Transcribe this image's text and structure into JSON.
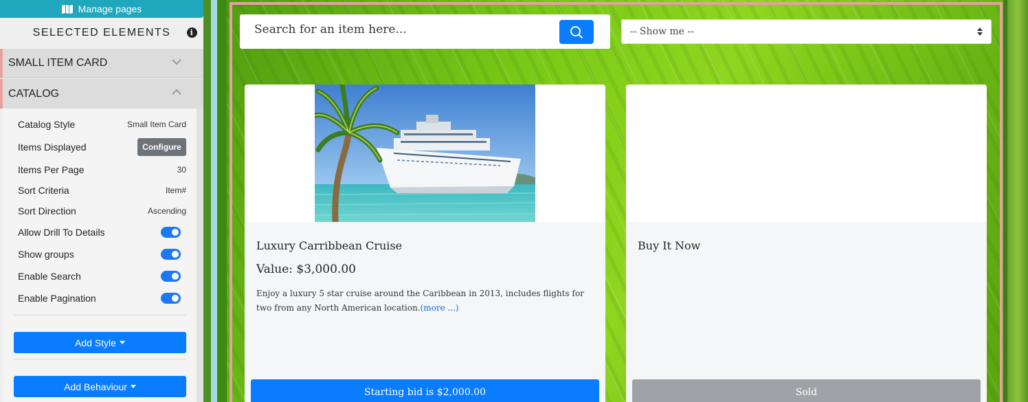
{
  "sidebar": {
    "manage_pages_label": "Manage pages",
    "selected_header": "SELECTED ELEMENTS",
    "info_glyph": "i",
    "accordions": [
      {
        "label": "SMALL ITEM CARD",
        "expanded": false
      },
      {
        "label": "CATALOG",
        "expanded": true
      }
    ],
    "catalog_props": {
      "catalog_style": {
        "label": "Catalog Style",
        "value": "Small Item Card"
      },
      "items_displayed": {
        "label": "Items Displayed",
        "button": "Configure"
      },
      "items_per_page": {
        "label": "Items Per Page",
        "value": "30"
      },
      "sort_criteria": {
        "label": "Sort Criteria",
        "value": "Item#"
      },
      "sort_direction": {
        "label": "Sort Direction",
        "value": "Ascending"
      },
      "allow_drill": {
        "label": "Allow Drill To Details",
        "on": true
      },
      "show_groups": {
        "label": "Show groups",
        "on": true
      },
      "enable_search": {
        "label": "Enable Search",
        "on": true
      },
      "enable_pagination": {
        "label": "Enable Pagination",
        "on": true
      }
    },
    "add_style_label": "Add Style",
    "add_behaviour_label": "Add Behaviour"
  },
  "main": {
    "search_placeholder": "Search for an item here...",
    "filter_select": {
      "selected": "-- Show me --"
    },
    "cards": [
      {
        "title": "Luxury Carribbean Cruise",
        "value": "Value: $3,000.00",
        "description": "Enjoy a luxury 5 star cruise around the Caribbean in 2013, includes flights for two from any North American location.",
        "more_link": "(more ...)",
        "button": "Starting bid is $2,000.00",
        "has_image": true
      },
      {
        "title": "Buy It Now",
        "button": "Sold",
        "has_image": false
      }
    ]
  },
  "colors": {
    "accent_blue": "#0a7cff",
    "teal": "#1ea7bd",
    "pink_frame": "#e6a0a2",
    "sold_grey": "#9fa3a7"
  }
}
